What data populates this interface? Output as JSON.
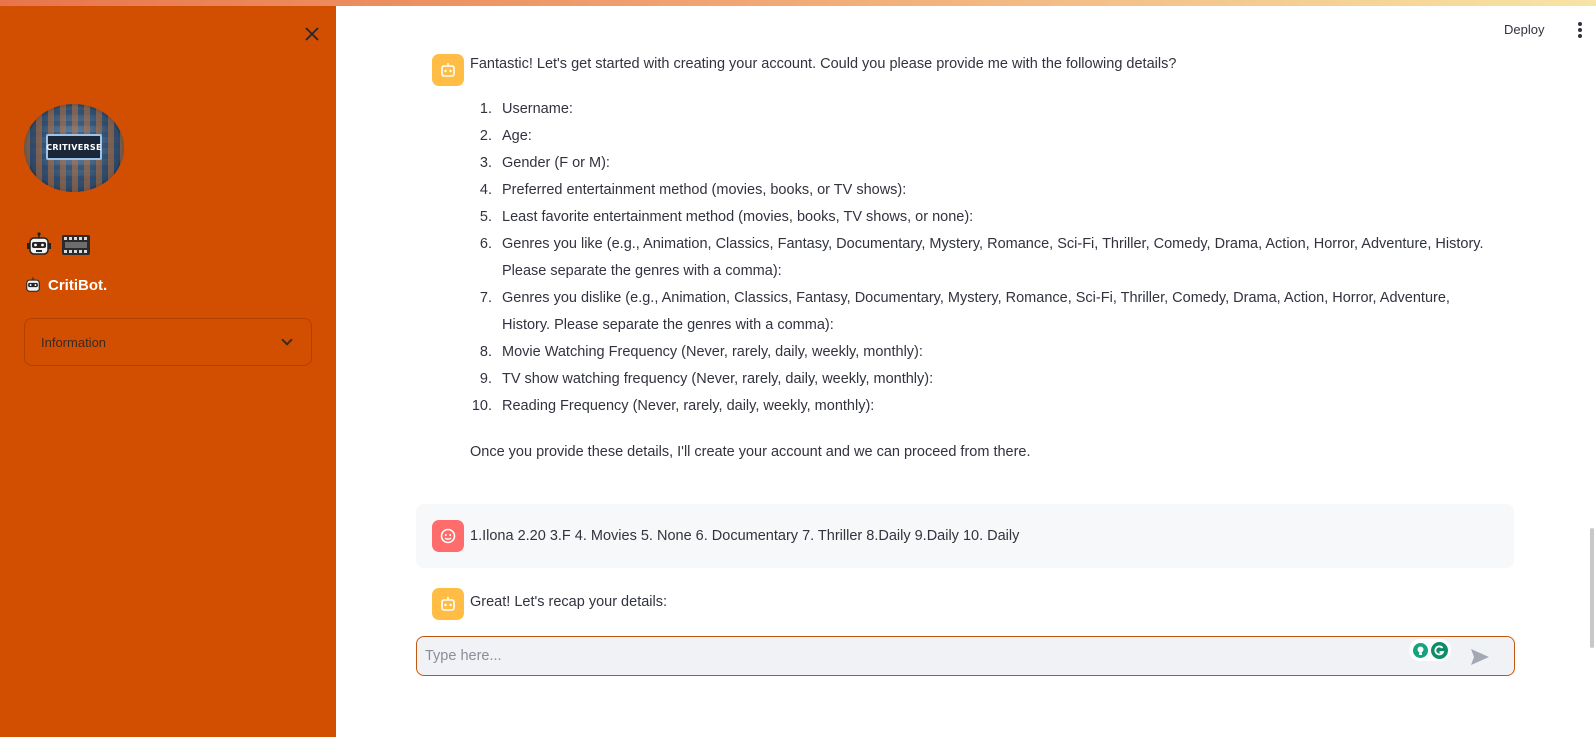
{
  "header": {
    "deploy_label": "Deploy"
  },
  "sidebar": {
    "logo_text": "CRITIVERSE",
    "bot_name": "CritiBot.",
    "expander_label": "Information"
  },
  "messages": {
    "intro": "Fantastic! Let's get started with creating your account. Could you please provide me with the following details?",
    "items": [
      {
        "num": "1.",
        "text": "Username:"
      },
      {
        "num": "2.",
        "text": "Age:"
      },
      {
        "num": "3.",
        "text": "Gender (F or M):"
      },
      {
        "num": "4.",
        "text": "Preferred entertainment method (movies, books, or TV shows):"
      },
      {
        "num": "5.",
        "text": "Least favorite entertainment method (movies, books, TV shows, or none):"
      },
      {
        "num": "6.",
        "text": "Genres you like (e.g., Animation, Classics, Fantasy, Documentary, Mystery, Romance, Sci-Fi, Thriller, Comedy, Drama, Action, Horror, Adventure, History. Please separate the genres with a comma):"
      },
      {
        "num": "7.",
        "text": "Genres you dislike (e.g., Animation, Classics, Fantasy, Documentary, Mystery, Romance, Sci-Fi, Thriller, Comedy, Drama, Action, Horror, Adventure, History. Please separate the genres with a comma):"
      },
      {
        "num": "8.",
        "text": "Movie Watching Frequency (Never, rarely, daily, weekly, monthly):"
      },
      {
        "num": "9.",
        "text": "TV show watching frequency (Never, rarely, daily, weekly, monthly):"
      },
      {
        "num": "10.",
        "text": "Reading Frequency (Never, rarely, daily, weekly, monthly):"
      }
    ],
    "outro": "Once you provide these details, I'll create your account and we can proceed from there.",
    "user_reply": "1.Ilona 2.20 3.F 4. Movies 5. None 6. Documentary 7. Thriller 8.Daily 9.Daily 10. Daily",
    "recap": "Great! Let's recap your details:"
  },
  "chat_input": {
    "placeholder": "Type here..."
  },
  "colors": {
    "sidebar_bg": "#d24f02",
    "bot_avatar": "#ffbd45",
    "user_avatar": "#ff6c6c"
  }
}
